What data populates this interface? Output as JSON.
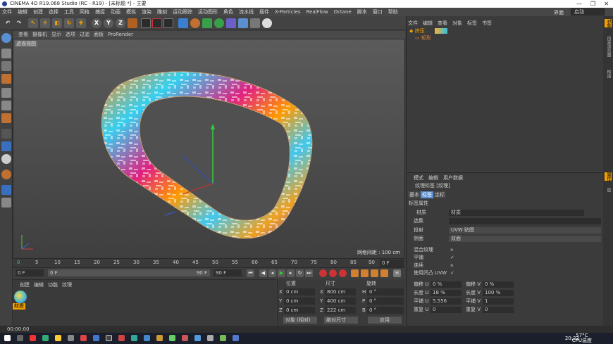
{
  "window": {
    "title": "CINEMA 4D R19.068 Studio (RC - R19) - [未标题 *] - 主要",
    "controls": [
      "—",
      "❐",
      "✕"
    ]
  },
  "menubar": {
    "items": [
      "文件",
      "编辑",
      "创建",
      "选择",
      "工具",
      "网格",
      "捕捉",
      "动画",
      "模拟",
      "渲染",
      "雕刻",
      "运动跟踪",
      "运动图形",
      "角色",
      "流水线",
      "插件",
      "X-Particles",
      "RealFlow",
      "Octane",
      "脚本",
      "窗口",
      "帮助"
    ],
    "layout_label": "界面",
    "layout_value": "启动"
  },
  "toolbar": {
    "axis_x": "X",
    "axis_y": "Y",
    "axis_z": "Z"
  },
  "viewport": {
    "menu": [
      "查看",
      "摄像机",
      "显示",
      "选项",
      "过滤",
      "面板",
      "ProRender"
    ],
    "label": "透视视图",
    "grid_info": "网格间距 : 100 cm"
  },
  "timeline": {
    "ticks": [
      "0",
      "5",
      "10",
      "15",
      "20",
      "25",
      "30",
      "35",
      "40",
      "45",
      "50",
      "55",
      "60",
      "65",
      "70",
      "75",
      "80",
      "85",
      "90"
    ],
    "current_frame": "0 F",
    "start": "0 F",
    "range_start": "0 F",
    "range_end": "90 F",
    "end": "90 F"
  },
  "materials": {
    "menu": [
      "创建",
      "编辑",
      "功能",
      "纹理"
    ],
    "items": [
      {
        "label": "材质"
      }
    ]
  },
  "coords": {
    "headers": [
      "位置",
      "尺寸",
      "旋转"
    ],
    "rows": [
      {
        "axis": "X",
        "pos": "0 cm",
        "size_axis": "X",
        "size": "800 cm",
        "rot_axis": "H",
        "rot": "0 °"
      },
      {
        "axis": "Y",
        "pos": "0 cm",
        "size_axis": "Y",
        "size": "400 cm",
        "rot_axis": "P",
        "rot": "0 °"
      },
      {
        "axis": "Z",
        "pos": "0 cm",
        "size_axis": "Z",
        "size": "222 cm",
        "rot_axis": "B",
        "rot": "0 °"
      }
    ],
    "mode_select": "对象 (相对)",
    "size_select": "绝对尺寸",
    "apply_button": "应用"
  },
  "objects": {
    "menu": [
      "文件",
      "编辑",
      "查看",
      "对象",
      "标签",
      "书签"
    ],
    "tree": [
      {
        "name": "挤压"
      },
      {
        "name": "矩形"
      }
    ]
  },
  "attributes": {
    "menu": [
      "模式",
      "编辑",
      "用户数据"
    ],
    "header": "纹理标签 [纹理]",
    "tabs": [
      "基本",
      "标签",
      "坐标"
    ],
    "section": "标签属性",
    "material_label": "材质",
    "material_value": "材质",
    "selection_label": "选集",
    "projection_label": "投射",
    "projection_value": "UVW 贴图",
    "side_label": "侧面",
    "side_value": "双面",
    "mix_label": "混合纹理",
    "tile_label": "平铺",
    "tile_check": "✓",
    "seamless_label": "连续",
    "uvw_label": "使用凹凸 UVW",
    "uvw_check": "✓",
    "params": [
      {
        "l1": "偏移 U",
        "v1": "0 %",
        "l2": "偏移 V",
        "v2": "0 %"
      },
      {
        "l1": "长度 U",
        "v1": "18 %",
        "l2": "长度 V",
        "v2": "100 %"
      },
      {
        "l1": "平铺 U",
        "v1": "5.556",
        "l2": "平铺 V",
        "v2": "1"
      },
      {
        "l1": "重复 U",
        "v1": "0",
        "l2": "重复 V",
        "v2": "0"
      }
    ]
  },
  "right_tabs": [
    "对象",
    "内容浏览器",
    "构造",
    "属性",
    "层"
  ],
  "status": {
    "time": "00:00:00"
  },
  "taskbar": {
    "temp": "57°C",
    "temp_label": "CPU温度",
    "clock": "20:22"
  }
}
